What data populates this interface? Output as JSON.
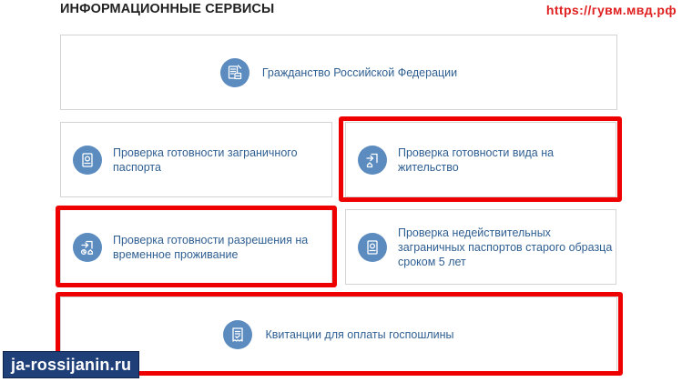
{
  "header": {
    "title": "ИНФОРМАЦИОННЫЕ СЕРВИСЫ",
    "site_url": "https://гувм.мвд.рф"
  },
  "services": [
    {
      "label": "Гражданство Российской Федерации",
      "icon": "citizenship-document-icon"
    },
    {
      "label": "Проверка готовности заграничного паспорта",
      "icon": "passport-icon"
    },
    {
      "label": "Проверка готовности вида на жительство",
      "icon": "residence-permit-icon"
    },
    {
      "label": "Проверка готовности разрешения на временное проживание",
      "icon": "temporary-residence-icon"
    },
    {
      "label": "Проверка недействительных заграничных паспортов старого образца сроком 5 лет",
      "icon": "passport-icon"
    },
    {
      "label": "Квитанции для оплаты госпошлины",
      "icon": "receipt-icon"
    }
  ],
  "watermark": {
    "text": "ja-rossijanin.ru"
  },
  "colors": {
    "accent": "#5b8bbf",
    "link_text": "#2f5f92",
    "highlight": "#ee0000",
    "watermark_bg": "#1f3f78"
  }
}
